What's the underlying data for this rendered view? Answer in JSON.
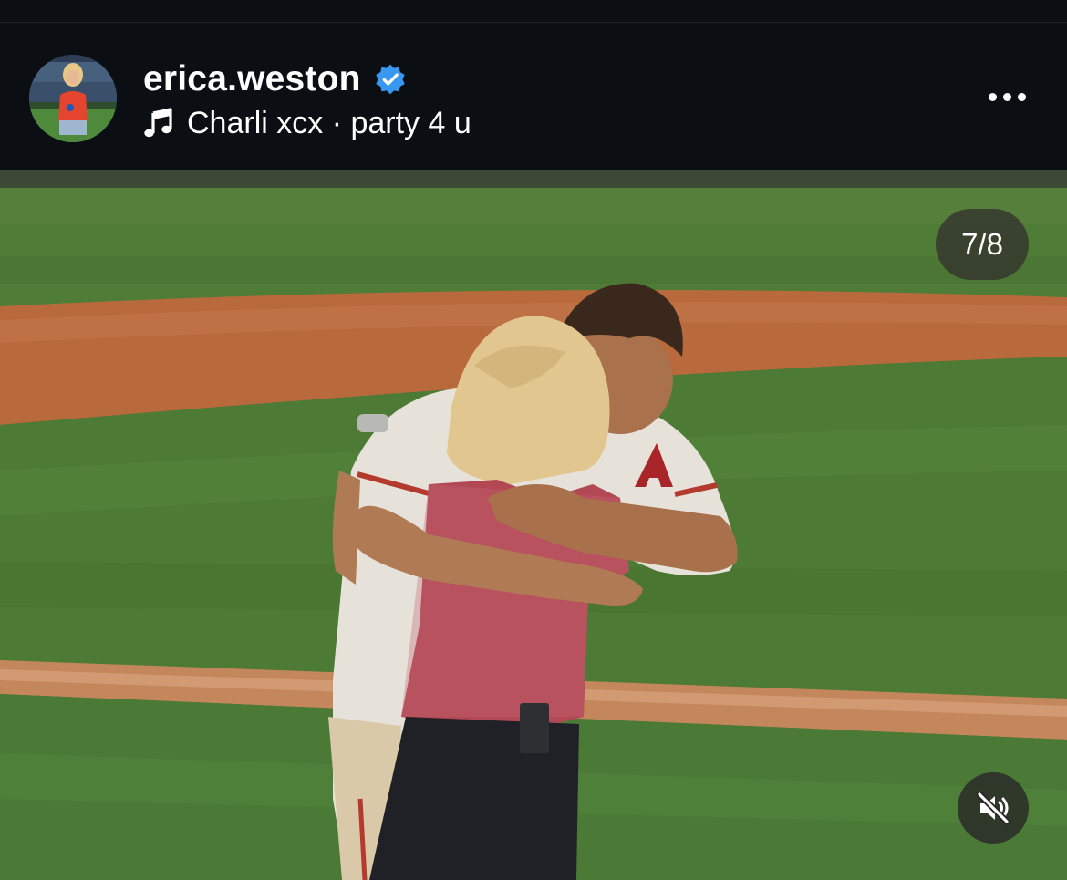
{
  "post": {
    "username": "erica.weston",
    "verified": true,
    "audio": "Charli xcx · party 4 u",
    "slide_counter": "7/8"
  },
  "icons": {
    "verified": "verified-badge-icon",
    "music": "music-note-icon",
    "more": "more-options-icon",
    "mute": "speaker-muted-icon"
  },
  "colors": {
    "background": "#0b0f14",
    "verified_blue": "#3897f0",
    "field_green": "#4d7a35",
    "infield_dirt": "#b86a3c"
  }
}
